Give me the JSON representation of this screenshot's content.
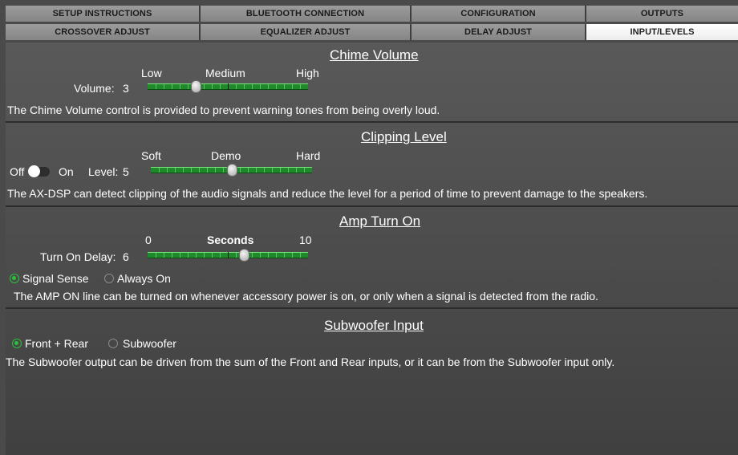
{
  "tabs": {
    "row1": [
      "SETUP INSTRUCTIONS",
      "BLUETOOTH CONNECTION",
      "CONFIGURATION",
      "OUTPUTS"
    ],
    "row2": [
      "CROSSOVER ADJUST",
      "EQUALIZER ADJUST",
      "DELAY ADJUST",
      "INPUT/LEVELS"
    ],
    "active": "INPUT/LEVELS"
  },
  "chime": {
    "title": "Chime Volume",
    "scale_low": "Low",
    "scale_mid": "Medium",
    "scale_high": "High",
    "label": "Volume:",
    "value": "3",
    "level_fraction": 0.3,
    "description": "The Chime Volume control is provided to prevent warning tones from being overly loud."
  },
  "clipping": {
    "title": "Clipping Level",
    "scale_low": "Soft",
    "scale_mid": "Demo",
    "scale_high": "Hard",
    "toggle_off": "Off",
    "toggle_on": "On",
    "toggle_state": "Off",
    "label": "Level:",
    "value": "5",
    "level_fraction": 0.5,
    "description": "The AX-DSP can detect clipping of the audio signals and reduce the level for a period of time to prevent damage to the speakers."
  },
  "amp": {
    "title": "Amp Turn On",
    "scale_low": "0",
    "scale_mid": "Seconds",
    "scale_high": "10",
    "label": "Turn On Delay:",
    "value": "6",
    "level_fraction": 0.6,
    "option_1": "Signal Sense",
    "option_2": "Always On",
    "selected": "Signal Sense",
    "description": "The AMP ON line can be turned on whenever accessory power is on, or only when a signal is detected from the radio."
  },
  "subwoofer": {
    "title": "Subwoofer Input",
    "option_1": "Front + Rear",
    "option_2": "Subwoofer",
    "selected": "Front + Rear",
    "description": "The Subwoofer output can be driven from the sum of the Front and Rear inputs, or it can be from the Subwoofer input only."
  },
  "colors": {
    "slider_green": "#1e8a2a",
    "radio_green": "#27c13a",
    "active_tab": "#ffffff"
  }
}
